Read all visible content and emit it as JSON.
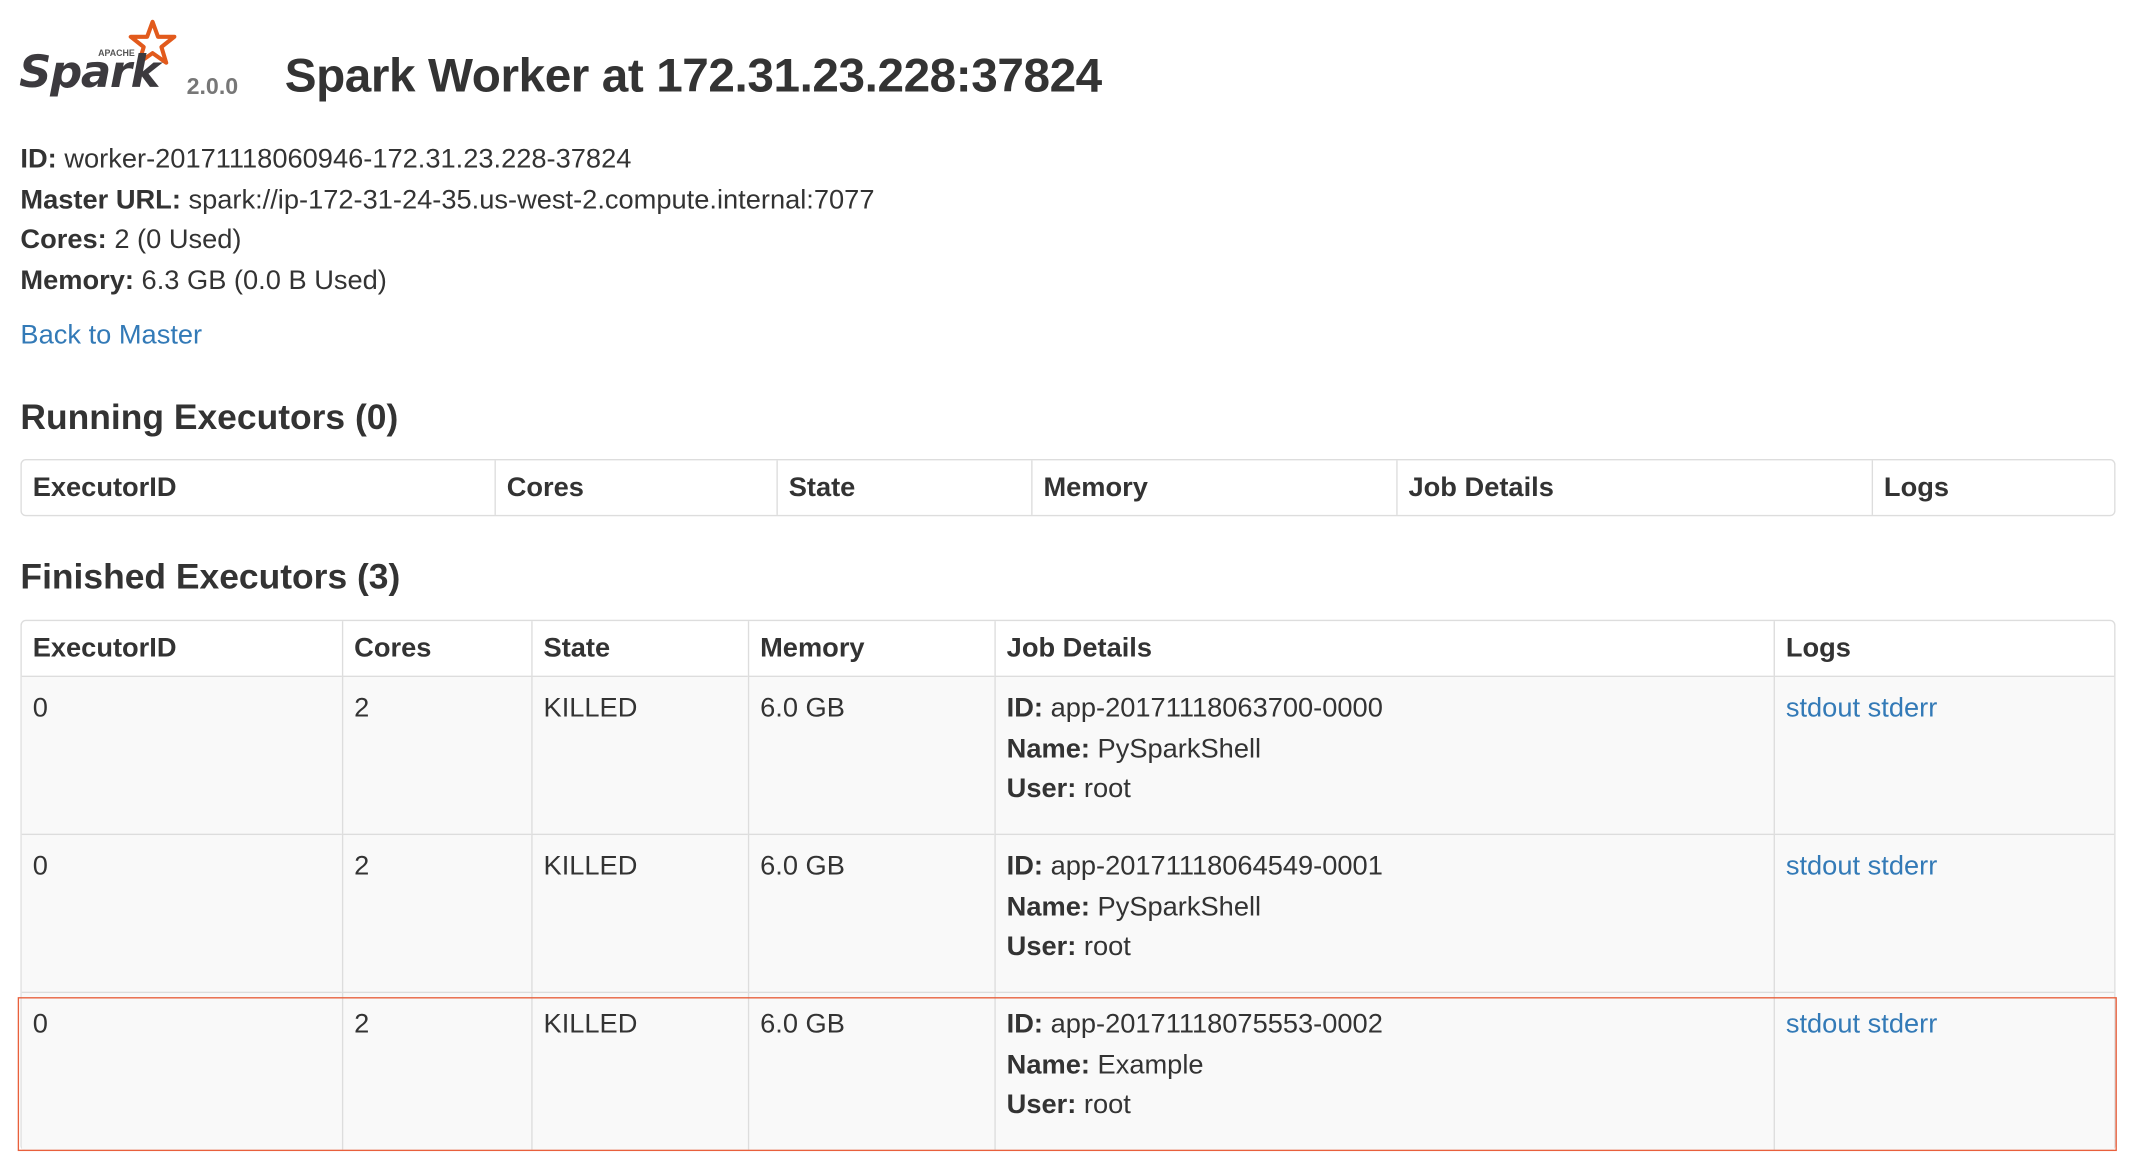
{
  "header": {
    "logo_top_text": "APACHE",
    "logo_text": "Spark",
    "version": "2.0.0",
    "title": "Spark Worker at 172.31.23.228:37824"
  },
  "info": {
    "id_label": "ID:",
    "id_value": "worker-20171118060946-172.31.23.228-37824",
    "master_url_label": "Master URL:",
    "master_url_value": "spark://ip-172-31-24-35.us-west-2.compute.internal:7077",
    "cores_label": "Cores:",
    "cores_value": "2 (0 Used)",
    "memory_label": "Memory:",
    "memory_value": "6.3 GB (0.0 B Used)"
  },
  "back_link": "Back to Master",
  "running": {
    "title": "Running Executors (0)",
    "columns": [
      "ExecutorID",
      "Cores",
      "State",
      "Memory",
      "Job Details",
      "Logs"
    ]
  },
  "finished": {
    "title": "Finished Executors (3)",
    "columns": [
      "ExecutorID",
      "Cores",
      "State",
      "Memory",
      "Job Details",
      "Logs"
    ],
    "rows": [
      {
        "executor_id": "0",
        "cores": "2",
        "state": "KILLED",
        "memory": "6.0 GB",
        "id_label": "ID:",
        "app_id": "app-20171118063700-0000",
        "name_label": "Name:",
        "name": "PySparkShell",
        "user_label": "User:",
        "user": "root",
        "stdout": "stdout",
        "stderr": "stderr"
      },
      {
        "executor_id": "0",
        "cores": "2",
        "state": "KILLED",
        "memory": "6.0 GB",
        "id_label": "ID:",
        "app_id": "app-20171118064549-0001",
        "name_label": "Name:",
        "name": "PySparkShell",
        "user_label": "User:",
        "user": "root",
        "stdout": "stdout",
        "stderr": "stderr"
      },
      {
        "executor_id": "0",
        "cores": "2",
        "state": "KILLED",
        "memory": "6.0 GB",
        "id_label": "ID:",
        "app_id": "app-20171118075553-0002",
        "name_label": "Name:",
        "name": "Example",
        "user_label": "User:",
        "user": "root",
        "stdout": "stdout",
        "stderr": "stderr"
      }
    ]
  },
  "colors": {
    "link": "#337ab7",
    "text": "#333333",
    "border": "#dddddd",
    "row_stripe": "#f9f9f9",
    "highlight": "#e8603c",
    "logo_star": "#e25a1c"
  }
}
